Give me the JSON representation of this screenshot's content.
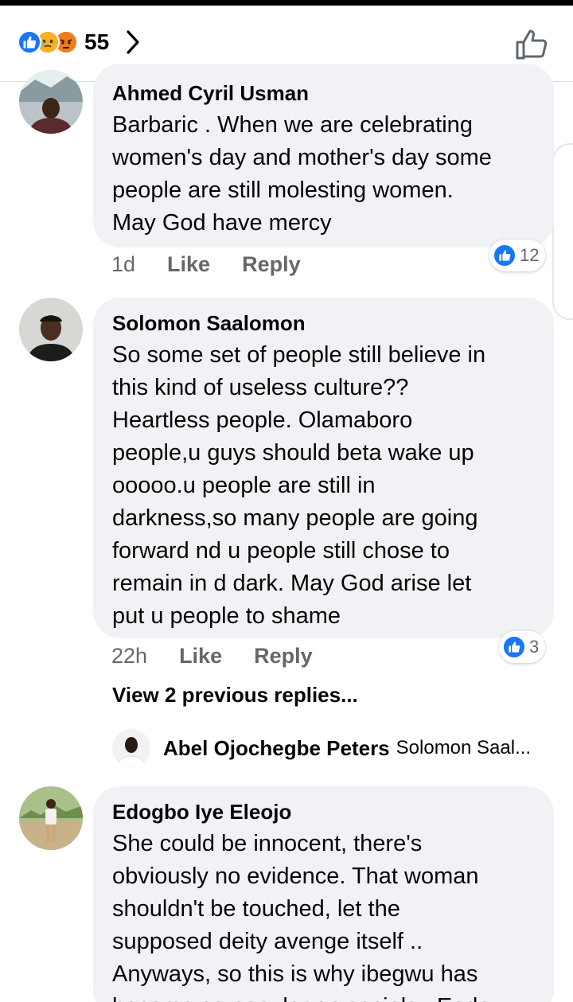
{
  "header": {
    "reactions": [
      "like-icon",
      "sad-icon",
      "angry-icon"
    ],
    "reaction_count": "55",
    "colors": {
      "like": "#1877f2",
      "sad": "#f7b125",
      "angry": "#e9710f"
    }
  },
  "comments": [
    {
      "author": "Ahmed Cyril Usman",
      "lines": [
        "Barbaric  . When we are celebrating",
        "women's day and mother's day some",
        "people are still molesting women.",
        "May God have mercy"
      ],
      "time": "1d",
      "like_label": "Like",
      "reply_label": "Reply",
      "reaction_count": "12"
    },
    {
      "author": "Solomon Saalomon",
      "lines": [
        "So some set of people still believe in",
        "this kind of useless culture??",
        "Heartless people. Olamaboro",
        "people,u guys should beta wake up",
        "ooooo.u people are still in",
        "darkness,so many people are going",
        "forward nd u people still chose to",
        "remain in d dark. May God arise let",
        "put u people to shame"
      ],
      "time": "22h",
      "like_label": "Like",
      "reply_label": "Reply",
      "reaction_count": "3",
      "view_replies": "View 2 previous replies...",
      "reply_preview": {
        "author": "Abel Ojochegbe Peters",
        "text": "Solomon Saal..."
      }
    },
    {
      "author": "Edogbo Iye Eleojo",
      "lines": [
        "She could be innocent, there's",
        "obviously no evidence. That woman",
        "shouldn't be touched, let the",
        "supposed deity avenge itself ..",
        "Anyways, so this is why ibegwu has",
        "become so popular on socials.. Eodo"
      ]
    }
  ]
}
